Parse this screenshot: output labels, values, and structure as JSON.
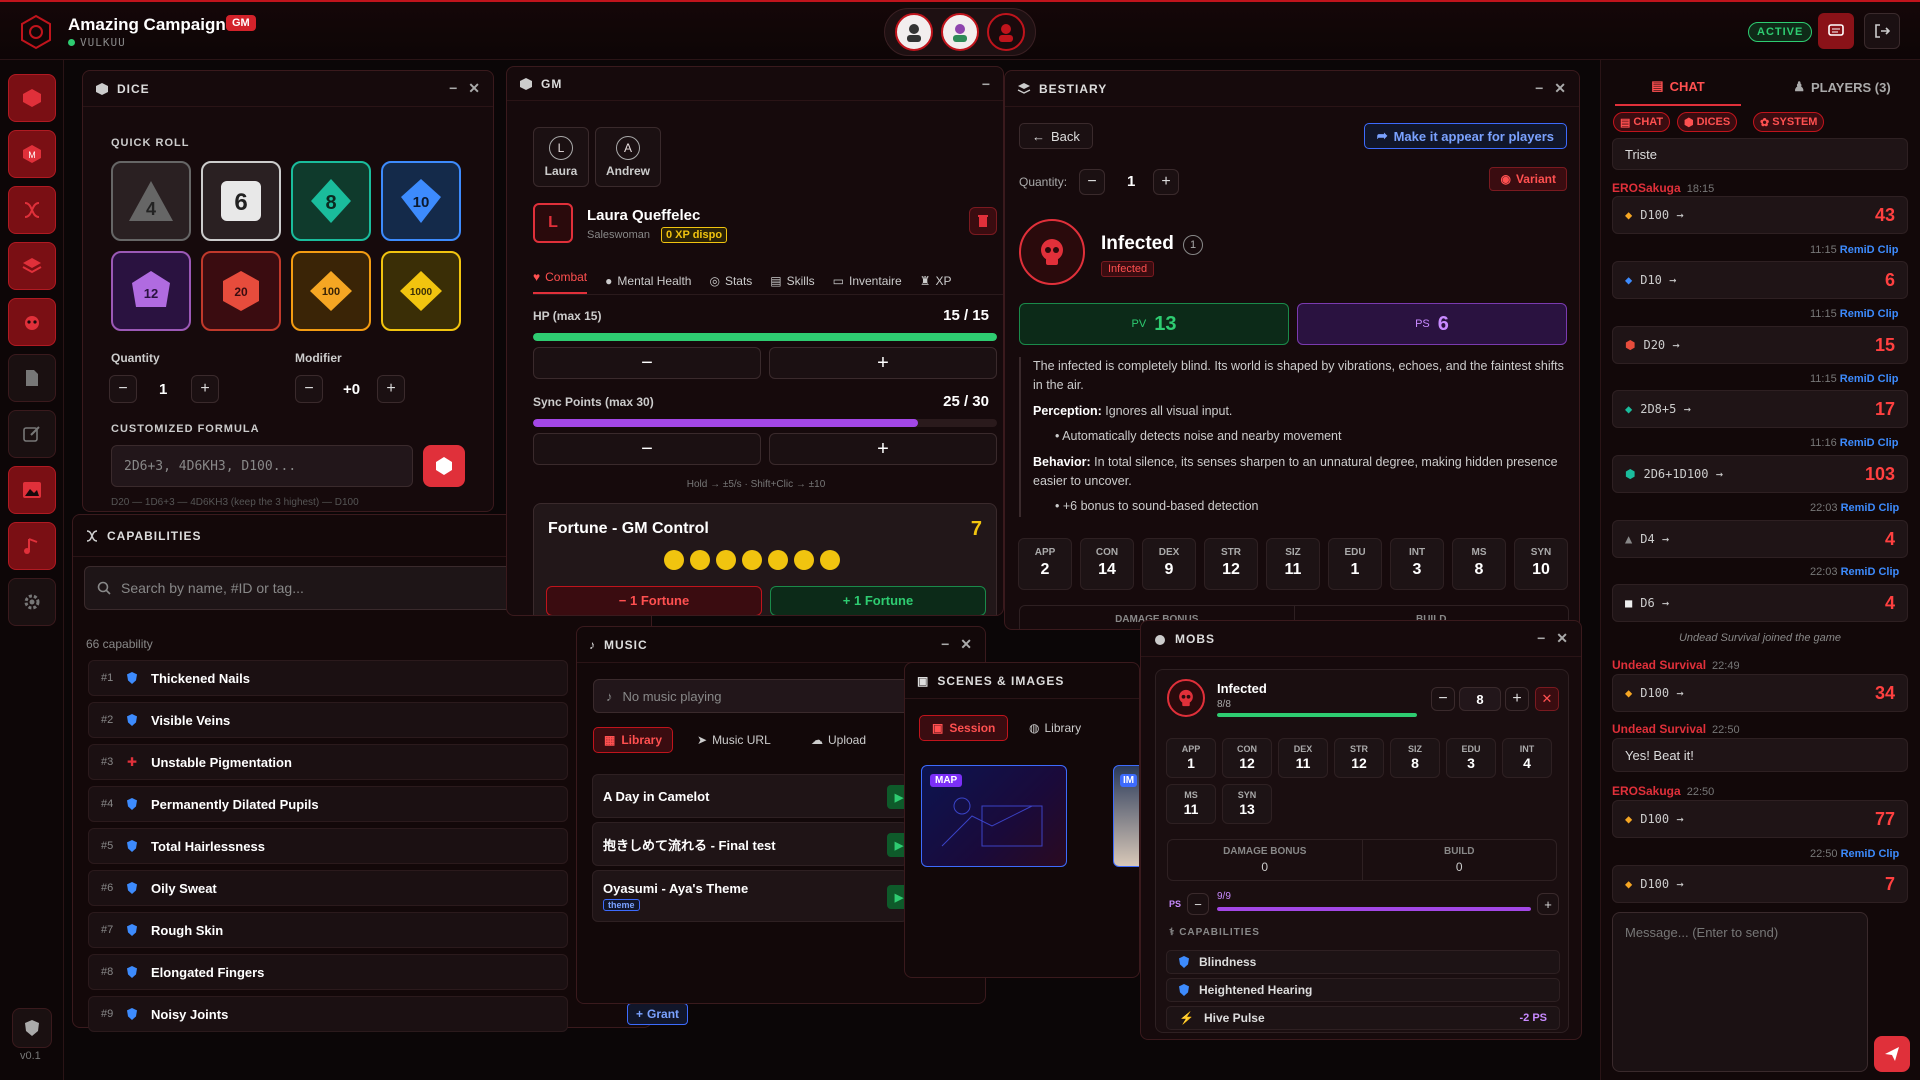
{
  "header": {
    "title": "Amazing Campaign",
    "role": "GM",
    "user": "VULKUU",
    "status": "ACTIVE"
  },
  "sidebar": {
    "version": "v0.1"
  },
  "dice": {
    "title": "DICE",
    "quick_roll": "QUICK ROLL",
    "dice": [
      "4",
      "6",
      "8",
      "10",
      "12",
      "20",
      "100",
      "1000"
    ],
    "quantity_label": "Quantity",
    "quantity": "1",
    "modifier_label": "Modifier",
    "modifier": "+0",
    "formula_label": "CUSTOMIZED FORMULA",
    "formula_placeholder": "2D6+3, 4D6KH3, D100...",
    "formula_hint": "D20 — 1D6+3 — 4D6KH3 (keep the 3 highest) — D100"
  },
  "capabilities": {
    "title": "CAPABILITIES",
    "search_placeholder": "Search by name, #ID or tag...",
    "count": "66 capability",
    "grant_label": "Grant",
    "items": [
      {
        "num": "#1",
        "name": "Thickened Nails"
      },
      {
        "num": "#2",
        "name": "Visible Veins"
      },
      {
        "num": "#3",
        "name": "Unstable Pigmentation"
      },
      {
        "num": "#4",
        "name": "Permanently Dilated Pupils"
      },
      {
        "num": "#5",
        "name": "Total Hairlessness"
      },
      {
        "num": "#6",
        "name": "Oily Sweat"
      },
      {
        "num": "#7",
        "name": "Rough Skin"
      },
      {
        "num": "#8",
        "name": "Elongated Fingers"
      },
      {
        "num": "#9",
        "name": "Noisy Joints"
      }
    ]
  },
  "gm": {
    "title": "GM",
    "players": [
      {
        "initial": "L",
        "name": "Laura"
      },
      {
        "initial": "A",
        "name": "Andrew"
      }
    ],
    "character": {
      "initial": "L",
      "name": "Laura Queffelec",
      "job": "Saleswoman",
      "xp": "0 XP dispo"
    },
    "tabs": [
      "Combat",
      "Mental Health",
      "Stats",
      "Skills",
      "Inventaire",
      "XP"
    ],
    "hp_label": "HP (max 15)",
    "hp": "15 / 15",
    "hp_pct": 100,
    "sync_label": "Sync Points (max 30)",
    "sync": "25 / 30",
    "sync_pct": 83,
    "hold_hint": "Hold → ±5/s · Shift+Clic → ±10",
    "fortune_title": "Fortune - GM Control",
    "fortune": "7",
    "fortune_minus": "− 1 Fortune",
    "fortune_plus": "+ 1 Fortune"
  },
  "bestiary": {
    "title": "BESTIARY",
    "back": "Back",
    "appear": "Make it appear for players",
    "quantity_label": "Quantity:",
    "quantity": "1",
    "variant": "Variant",
    "name": "Infected",
    "level": "1",
    "tag": "Infected",
    "pv_label": "PV",
    "pv": "13",
    "ps_label": "PS",
    "ps": "6",
    "desc": "The infected is completely blind. Its world is shaped by vibrations, echoes, and the faintest shifts in the air.",
    "perception_label": "Perception:",
    "perception": "Ignores all visual input.",
    "perception_bullet": "Automatically detects noise and nearby movement",
    "behavior_label": "Behavior:",
    "behavior": "In total silence, its senses sharpen to an unnatural degree, making hidden presence easier to uncover.",
    "behavior_bullet": "+6 bonus to sound-based detection",
    "stats": [
      {
        "k": "APP",
        "v": "2"
      },
      {
        "k": "CON",
        "v": "14"
      },
      {
        "k": "DEX",
        "v": "9"
      },
      {
        "k": "STR",
        "v": "12"
      },
      {
        "k": "SIZ",
        "v": "11"
      },
      {
        "k": "EDU",
        "v": "1"
      },
      {
        "k": "INT",
        "v": "3"
      },
      {
        "k": "MS",
        "v": "8"
      },
      {
        "k": "SYN",
        "v": "10"
      }
    ],
    "damage_bonus": "DAMAGE BONUS",
    "build": "BUILD"
  },
  "music": {
    "title": "MUSIC",
    "now": "No music playing",
    "tabs": [
      "Library",
      "Music URL",
      "Upload"
    ],
    "tracks": [
      {
        "name": "A Day in Camelot",
        "tag": ""
      },
      {
        "name": "抱きしめて流れる - Final test",
        "tag": ""
      },
      {
        "name": "Oyasumi - Aya's Theme",
        "tag": "theme"
      }
    ]
  },
  "scenes": {
    "title": "SCENES & IMAGES",
    "tabs": [
      "Session",
      "Library"
    ],
    "map_tag": "MAP",
    "img_tag": "IM"
  },
  "mobs": {
    "title": "MOBS",
    "name": "Infected",
    "hp": "8/8",
    "hp_pct": 100,
    "count": "8",
    "stats": [
      {
        "k": "APP",
        "v": "1"
      },
      {
        "k": "CON",
        "v": "12"
      },
      {
        "k": "DEX",
        "v": "11"
      },
      {
        "k": "STR",
        "v": "12"
      },
      {
        "k": "SIZ",
        "v": "8"
      },
      {
        "k": "EDU",
        "v": "3"
      },
      {
        "k": "INT",
        "v": "4"
      },
      {
        "k": "MS",
        "v": "11"
      },
      {
        "k": "SYN",
        "v": "13"
      }
    ],
    "damage_label": "DAMAGE BONUS",
    "damage": "0",
    "build_label": "BUILD",
    "build": "0",
    "ps_label": "PS",
    "ps": "9/9",
    "ps_pct": 100,
    "caps_label": "CAPABILITIES",
    "caps": [
      {
        "name": "Blindness",
        "cost": ""
      },
      {
        "name": "Heightened Hearing",
        "cost": ""
      },
      {
        "name": "Hive Pulse",
        "cost": "-2 PS"
      }
    ]
  },
  "chat": {
    "tab_chat": "CHAT",
    "tab_players": "PLAYERS (3)",
    "filters": [
      "CHAT",
      "DICES",
      "SYSTEM"
    ],
    "placeholder": "Message... (Enter to send)",
    "first_msg": "Triste",
    "m1_author": "EROSakuga",
    "m1_time": "18:15",
    "m1_dice": "D100 →",
    "m1_res": "43",
    "m2_meta": "11:15",
    "m2_by": "RemiD Clip",
    "m2_dice": "D10 →",
    "m2_res": "6",
    "m3_meta": "11:15",
    "m3_by": "RemiD Clip",
    "m3_dice": "D20 →",
    "m3_res": "15",
    "m4_meta": "11:15",
    "m4_by": "RemiD Clip",
    "m4_dice": "2D8+5 →",
    "m4_res": "17",
    "m5_meta": "11:16",
    "m5_by": "RemiD Clip",
    "m5_dice": "2D6+1D100 →",
    "m5_res": "103",
    "m6_meta": "22:03",
    "m6_by": "RemiD Clip",
    "m6_dice": "D4 →",
    "m6_res": "4",
    "m7_meta": "22:03",
    "m7_by": "RemiD Clip",
    "m7_dice": "D6 →",
    "m7_res": "4",
    "system": "Undead Survival joined the game",
    "m8_author": "Undead Survival",
    "m8_time": "22:49",
    "m8_dice": "D100 →",
    "m8_res": "34",
    "m9_author": "Undead Survival",
    "m9_time": "22:50",
    "m9_text": "Yes! Beat it!",
    "m10_author": "EROSakuga",
    "m10_time": "22:50",
    "m10_dice": "D100 →",
    "m10_res": "77",
    "m11_meta": "22:50",
    "m11_by": "RemiD Clip",
    "m11_dice": "D100 →",
    "m11_res": "7"
  }
}
